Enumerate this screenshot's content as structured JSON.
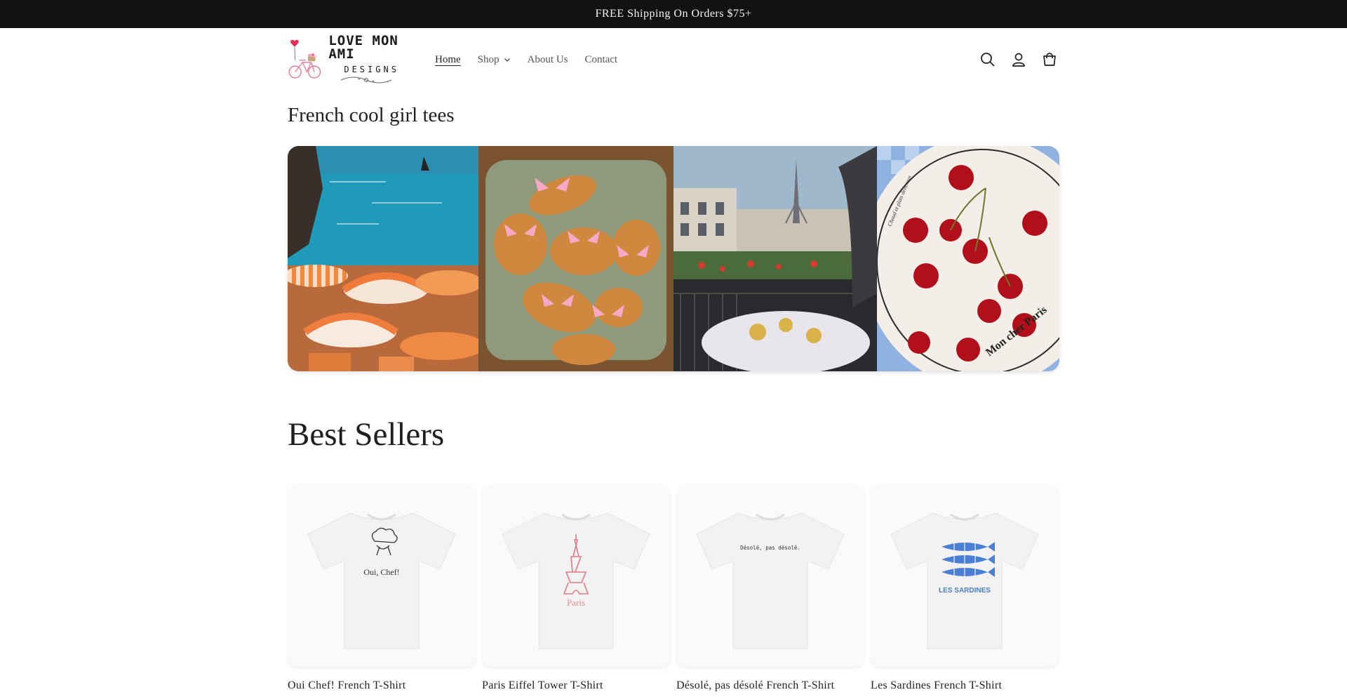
{
  "announcement": {
    "text": "FREE Shipping On Orders $75+"
  },
  "logo": {
    "line1": "LOVE MON AMI",
    "line2": "DESIGNS"
  },
  "nav": {
    "items": [
      {
        "label": "Home",
        "active": true
      },
      {
        "label": "Shop",
        "has_dropdown": true
      },
      {
        "label": "About Us"
      },
      {
        "label": "Contact"
      }
    ]
  },
  "header_icons": [
    "search-icon",
    "account-icon",
    "cart-icon"
  ],
  "collection": {
    "title": "French cool girl tees",
    "images": [
      "beach-umbrellas",
      "croissants-with-pink-bows",
      "paris-balcony-eiffel-tower",
      "cherries-on-plate"
    ],
    "plate_text": "Mon cher Paris",
    "plate_rim_text": "Chaud et plats délicieux"
  },
  "best_sellers": {
    "title": "Best Sellers",
    "products": [
      {
        "title": "Oui Chef! French T-Shirt",
        "print": "Oui, Chef!"
      },
      {
        "title": "Paris Eiffel Tower T-Shirt",
        "print": "Paris"
      },
      {
        "title": "Désolé, pas désolé French T-Shirt",
        "print": "Désolé, pas désolé."
      },
      {
        "title": "Les Sardines French T-Shirt",
        "print": "LES SARDINES"
      }
    ]
  },
  "colors": {
    "announce_bg": "#121212",
    "heart": "#e0315a",
    "bike": "#f0a0b4",
    "sardine_blue": "#4a7fd4",
    "paris_pink": "#e88a96"
  }
}
